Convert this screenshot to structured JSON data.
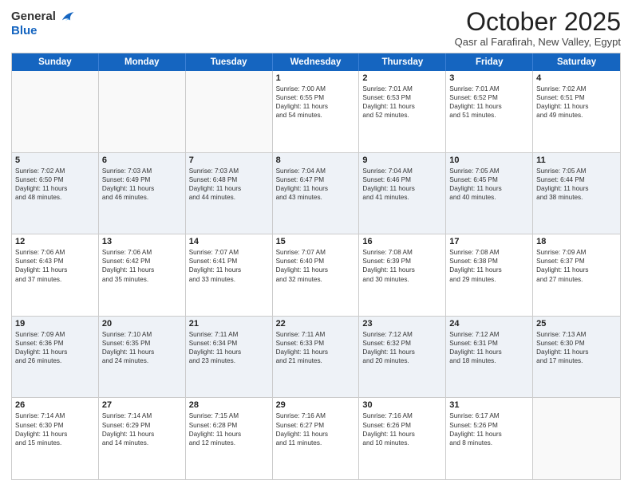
{
  "header": {
    "logo_general": "General",
    "logo_blue": "Blue",
    "month_title": "October 2025",
    "location": "Qasr al Farafirah, New Valley, Egypt"
  },
  "days_of_week": [
    "Sunday",
    "Monday",
    "Tuesday",
    "Wednesday",
    "Thursday",
    "Friday",
    "Saturday"
  ],
  "rows": [
    {
      "cells": [
        {
          "day": "",
          "lines": []
        },
        {
          "day": "",
          "lines": []
        },
        {
          "day": "",
          "lines": []
        },
        {
          "day": "1",
          "lines": [
            "Sunrise: 7:00 AM",
            "Sunset: 6:55 PM",
            "Daylight: 11 hours",
            "and 54 minutes."
          ]
        },
        {
          "day": "2",
          "lines": [
            "Sunrise: 7:01 AM",
            "Sunset: 6:53 PM",
            "Daylight: 11 hours",
            "and 52 minutes."
          ]
        },
        {
          "day": "3",
          "lines": [
            "Sunrise: 7:01 AM",
            "Sunset: 6:52 PM",
            "Daylight: 11 hours",
            "and 51 minutes."
          ]
        },
        {
          "day": "4",
          "lines": [
            "Sunrise: 7:02 AM",
            "Sunset: 6:51 PM",
            "Daylight: 11 hours",
            "and 49 minutes."
          ]
        }
      ]
    },
    {
      "alt": true,
      "cells": [
        {
          "day": "5",
          "lines": [
            "Sunrise: 7:02 AM",
            "Sunset: 6:50 PM",
            "Daylight: 11 hours",
            "and 48 minutes."
          ]
        },
        {
          "day": "6",
          "lines": [
            "Sunrise: 7:03 AM",
            "Sunset: 6:49 PM",
            "Daylight: 11 hours",
            "and 46 minutes."
          ]
        },
        {
          "day": "7",
          "lines": [
            "Sunrise: 7:03 AM",
            "Sunset: 6:48 PM",
            "Daylight: 11 hours",
            "and 44 minutes."
          ]
        },
        {
          "day": "8",
          "lines": [
            "Sunrise: 7:04 AM",
            "Sunset: 6:47 PM",
            "Daylight: 11 hours",
            "and 43 minutes."
          ]
        },
        {
          "day": "9",
          "lines": [
            "Sunrise: 7:04 AM",
            "Sunset: 6:46 PM",
            "Daylight: 11 hours",
            "and 41 minutes."
          ]
        },
        {
          "day": "10",
          "lines": [
            "Sunrise: 7:05 AM",
            "Sunset: 6:45 PM",
            "Daylight: 11 hours",
            "and 40 minutes."
          ]
        },
        {
          "day": "11",
          "lines": [
            "Sunrise: 7:05 AM",
            "Sunset: 6:44 PM",
            "Daylight: 11 hours",
            "and 38 minutes."
          ]
        }
      ]
    },
    {
      "cells": [
        {
          "day": "12",
          "lines": [
            "Sunrise: 7:06 AM",
            "Sunset: 6:43 PM",
            "Daylight: 11 hours",
            "and 37 minutes."
          ]
        },
        {
          "day": "13",
          "lines": [
            "Sunrise: 7:06 AM",
            "Sunset: 6:42 PM",
            "Daylight: 11 hours",
            "and 35 minutes."
          ]
        },
        {
          "day": "14",
          "lines": [
            "Sunrise: 7:07 AM",
            "Sunset: 6:41 PM",
            "Daylight: 11 hours",
            "and 33 minutes."
          ]
        },
        {
          "day": "15",
          "lines": [
            "Sunrise: 7:07 AM",
            "Sunset: 6:40 PM",
            "Daylight: 11 hours",
            "and 32 minutes."
          ]
        },
        {
          "day": "16",
          "lines": [
            "Sunrise: 7:08 AM",
            "Sunset: 6:39 PM",
            "Daylight: 11 hours",
            "and 30 minutes."
          ]
        },
        {
          "day": "17",
          "lines": [
            "Sunrise: 7:08 AM",
            "Sunset: 6:38 PM",
            "Daylight: 11 hours",
            "and 29 minutes."
          ]
        },
        {
          "day": "18",
          "lines": [
            "Sunrise: 7:09 AM",
            "Sunset: 6:37 PM",
            "Daylight: 11 hours",
            "and 27 minutes."
          ]
        }
      ]
    },
    {
      "alt": true,
      "cells": [
        {
          "day": "19",
          "lines": [
            "Sunrise: 7:09 AM",
            "Sunset: 6:36 PM",
            "Daylight: 11 hours",
            "and 26 minutes."
          ]
        },
        {
          "day": "20",
          "lines": [
            "Sunrise: 7:10 AM",
            "Sunset: 6:35 PM",
            "Daylight: 11 hours",
            "and 24 minutes."
          ]
        },
        {
          "day": "21",
          "lines": [
            "Sunrise: 7:11 AM",
            "Sunset: 6:34 PM",
            "Daylight: 11 hours",
            "and 23 minutes."
          ]
        },
        {
          "day": "22",
          "lines": [
            "Sunrise: 7:11 AM",
            "Sunset: 6:33 PM",
            "Daylight: 11 hours",
            "and 21 minutes."
          ]
        },
        {
          "day": "23",
          "lines": [
            "Sunrise: 7:12 AM",
            "Sunset: 6:32 PM",
            "Daylight: 11 hours",
            "and 20 minutes."
          ]
        },
        {
          "day": "24",
          "lines": [
            "Sunrise: 7:12 AM",
            "Sunset: 6:31 PM",
            "Daylight: 11 hours",
            "and 18 minutes."
          ]
        },
        {
          "day": "25",
          "lines": [
            "Sunrise: 7:13 AM",
            "Sunset: 6:30 PM",
            "Daylight: 11 hours",
            "and 17 minutes."
          ]
        }
      ]
    },
    {
      "cells": [
        {
          "day": "26",
          "lines": [
            "Sunrise: 7:14 AM",
            "Sunset: 6:30 PM",
            "Daylight: 11 hours",
            "and 15 minutes."
          ]
        },
        {
          "day": "27",
          "lines": [
            "Sunrise: 7:14 AM",
            "Sunset: 6:29 PM",
            "Daylight: 11 hours",
            "and 14 minutes."
          ]
        },
        {
          "day": "28",
          "lines": [
            "Sunrise: 7:15 AM",
            "Sunset: 6:28 PM",
            "Daylight: 11 hours",
            "and 12 minutes."
          ]
        },
        {
          "day": "29",
          "lines": [
            "Sunrise: 7:16 AM",
            "Sunset: 6:27 PM",
            "Daylight: 11 hours",
            "and 11 minutes."
          ]
        },
        {
          "day": "30",
          "lines": [
            "Sunrise: 7:16 AM",
            "Sunset: 6:26 PM",
            "Daylight: 11 hours",
            "and 10 minutes."
          ]
        },
        {
          "day": "31",
          "lines": [
            "Sunrise: 6:17 AM",
            "Sunset: 5:26 PM",
            "Daylight: 11 hours",
            "and 8 minutes."
          ]
        },
        {
          "day": "",
          "lines": []
        }
      ]
    }
  ]
}
